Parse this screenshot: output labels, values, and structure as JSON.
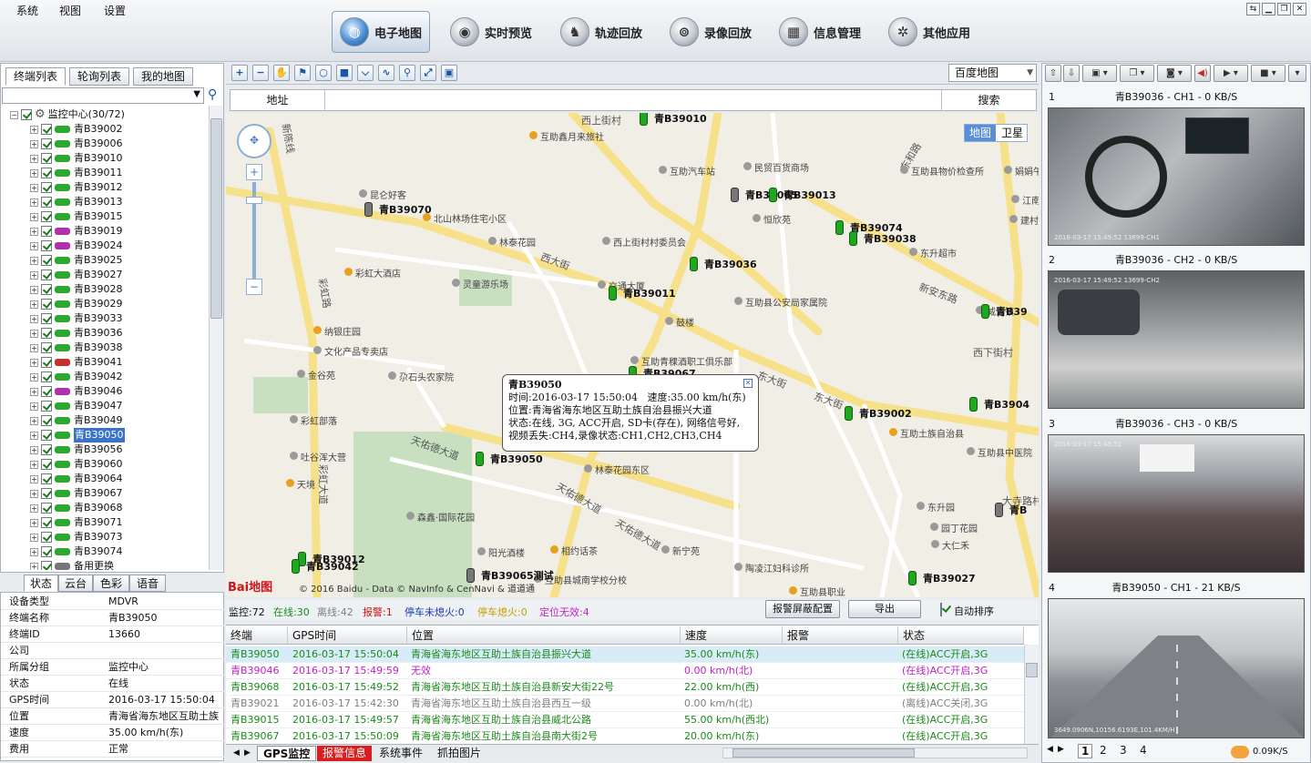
{
  "menu": [
    "系统",
    "视图",
    "设置"
  ],
  "nav": [
    {
      "label": "电子地图",
      "icon": "globe-icon",
      "active": true
    },
    {
      "label": "实时预览",
      "icon": "camera-icon"
    },
    {
      "label": "轨迹回放",
      "icon": "track-icon"
    },
    {
      "label": "录像回放",
      "icon": "video-reel-icon"
    },
    {
      "label": "信息管理",
      "icon": "info-icon"
    },
    {
      "label": "其他应用",
      "icon": "apps-icon"
    }
  ],
  "left_tabs": [
    "终端列表",
    "轮询列表",
    "我的地图"
  ],
  "tree": {
    "root": "监控中心(30/72)",
    "selected": "青B39050",
    "items": [
      {
        "name": "青B39002",
        "color": "#2ea82e"
      },
      {
        "name": "青B39006",
        "color": "#2ea82e"
      },
      {
        "name": "青B39010",
        "color": "#2ea82e"
      },
      {
        "name": "青B39011",
        "color": "#2ea82e"
      },
      {
        "name": "青B39012",
        "color": "#2ea82e"
      },
      {
        "name": "青B39013",
        "color": "#2ea82e"
      },
      {
        "name": "青B39015",
        "color": "#2ea82e"
      },
      {
        "name": "青B39019",
        "color": "#b030b0"
      },
      {
        "name": "青B39024",
        "color": "#b030b0"
      },
      {
        "name": "青B39025",
        "color": "#2ea82e"
      },
      {
        "name": "青B39027",
        "color": "#2ea82e"
      },
      {
        "name": "青B39028",
        "color": "#2ea82e"
      },
      {
        "name": "青B39029",
        "color": "#2ea82e"
      },
      {
        "name": "青B39033",
        "color": "#2ea82e"
      },
      {
        "name": "青B39036",
        "color": "#2ea82e"
      },
      {
        "name": "青B39038",
        "color": "#2ea82e"
      },
      {
        "name": "青B39041",
        "color": "#c83030"
      },
      {
        "name": "青B39042",
        "color": "#2ea82e"
      },
      {
        "name": "青B39046",
        "color": "#b030b0"
      },
      {
        "name": "青B39047",
        "color": "#2ea82e"
      },
      {
        "name": "青B39049",
        "color": "#2ea82e"
      },
      {
        "name": "青B39050",
        "color": "#2ea82e"
      },
      {
        "name": "青B39056",
        "color": "#2ea82e"
      },
      {
        "name": "青B39060",
        "color": "#2ea82e"
      },
      {
        "name": "青B39064",
        "color": "#2ea82e"
      },
      {
        "name": "青B39067",
        "color": "#2ea82e"
      },
      {
        "name": "青B39068",
        "color": "#2ea82e"
      },
      {
        "name": "青B39071",
        "color": "#2ea82e"
      },
      {
        "name": "青B39073",
        "color": "#2ea82e"
      },
      {
        "name": "青B39074",
        "color": "#2ea82e"
      },
      {
        "name": "备用更换",
        "color": "#777777"
      }
    ]
  },
  "status_tabs": [
    "状态",
    "云台",
    "色彩",
    "语音"
  ],
  "device_info": [
    {
      "k": "设备类型",
      "v": "MDVR"
    },
    {
      "k": "终端名称",
      "v": "青B39050"
    },
    {
      "k": "终端ID",
      "v": "13660"
    },
    {
      "k": "公司",
      "v": ""
    },
    {
      "k": "所属分组",
      "v": "监控中心"
    },
    {
      "k": "状态",
      "v": "在线"
    },
    {
      "k": "GPS时间",
      "v": "2016-03-17 15:50:04"
    },
    {
      "k": "位置",
      "v": "青海省海东地区互助土族"
    },
    {
      "k": "速度",
      "v": "35.00 km/h(东)"
    },
    {
      "k": "费用",
      "v": "正常"
    }
  ],
  "map": {
    "provider": "百度地图",
    "address_label": "地址",
    "search_label": "搜索",
    "type_map": "地图",
    "type_sat": "卫星",
    "copyright": "© 2016 Baidu - Data © NavInfo & CenNavi & 道道通",
    "logo": "Bai地图",
    "roads": [
      "西大街",
      "东大街",
      "东大街",
      "新安东路",
      "天佑德大道",
      "天佑德大道",
      "天佑德大道",
      "彩虹大道",
      "新陈线",
      "彩虹路",
      "东和路",
      "西上街村",
      "西下街村",
      "大寺路村"
    ],
    "pois": [
      "互助鑫月来旅社",
      "互助汽车站",
      "民贸百货商场",
      "互助县物价检查所",
      "昆仑好客",
      "北山林场住宅小区",
      "林泰花园",
      "西上街村村委员会",
      "恒欣苑",
      "东升超市",
      "彩虹大酒店",
      "灵童游乐场",
      "交通大厦",
      "互助县公安局家属院",
      "鼓楼",
      "纳银庄园",
      "文化产品专卖店",
      "金谷苑",
      "尕石头农家院",
      "互助青稞酒职工俱乐部",
      "互助土族自治县",
      "彩虹部落",
      "互助县中医院",
      "吐谷浑大营",
      "林泰花园东区",
      "天境",
      "森鑫·国际花园",
      "东升园",
      "园丁花园",
      "阳光酒楼",
      "相约话茶",
      "新宁苑",
      "大仁禾",
      "互助县城南学校分校",
      "陶凌江妇科诊所",
      "互助县职业",
      "威远镇",
      "娟娟午",
      "江南",
      "建村"
    ],
    "vehicles": [
      {
        "id": "青B39010"
      },
      {
        "id": "青B39065"
      },
      {
        "id": "青B39013"
      },
      {
        "id": "青B39070"
      },
      {
        "id": "青B39074"
      },
      {
        "id": "青B39038"
      },
      {
        "id": "青B39036"
      },
      {
        "id": "青B39011"
      },
      {
        "id": "青B39"
      },
      {
        "id": "青B39067"
      },
      {
        "id": "青B39002"
      },
      {
        "id": "青B3904"
      },
      {
        "id": "青B39050"
      },
      {
        "id": "青B39012"
      },
      {
        "id": "青B39042"
      },
      {
        "id": "青B39065测试"
      },
      {
        "id": "青B39027"
      },
      {
        "id": "青B"
      }
    ],
    "popup": {
      "title": "青B39050",
      "time": "时间:2016-03-17 15:50:04",
      "speed": "速度:35.00 km/h(东)",
      "position": "位置:青海省海东地区互助土族自治县振兴大道",
      "status": "状态:在线, 3G, ACC开启, SD卡(存在), 网络信号好,",
      "video": "视频丢失:CH4,录像状态:CH1,CH2,CH3,CH4"
    }
  },
  "stats": {
    "monitor": "监控:72",
    "online": "在线:30",
    "offline": "离线:42",
    "alarm": "报警:1",
    "stop_off": "停车未熄火:0",
    "stop_on": "停车熄火:0",
    "invalid": "定位无效:4",
    "btn_alarm_cfg": "报警屏蔽配置",
    "btn_export": "导出",
    "auto_sort": "自动排序"
  },
  "grid": {
    "headers": [
      "终端",
      "GPS时间",
      "位置",
      "速度",
      "报警",
      "状态"
    ],
    "rows": [
      {
        "term": "青B39050",
        "time": "2016-03-17 15:50:04",
        "pos": "青海省海东地区互助土族自治县振兴大道",
        "speed": "35.00 km/h(东)",
        "alarm": "",
        "status": "(在线)ACC开启,3G",
        "color": "#1a8a1a"
      },
      {
        "term": "青B39046",
        "time": "2016-03-17 15:49:59",
        "pos": "无效",
        "speed": "0.00 km/h(北)",
        "alarm": "",
        "status": "(在线)ACC开启,3G",
        "color": "#c020c0"
      },
      {
        "term": "青B39068",
        "time": "2016-03-17 15:49:52",
        "pos": "青海省海东地区互助土族自治县新安大街22号",
        "speed": "22.00 km/h(西)",
        "alarm": "",
        "status": "(在线)ACC开启,3G",
        "color": "#1a8a1a"
      },
      {
        "term": "青B39021",
        "time": "2016-03-17 15:42:30",
        "pos": "青海省海东地区互助土族自治县西互一级",
        "speed": "0.00 km/h(北)",
        "alarm": "",
        "status": "(离线)ACC关闭,3G",
        "color": "#808080"
      },
      {
        "term": "青B39015",
        "time": "2016-03-17 15:49:57",
        "pos": "青海省海东地区互助土族自治县威北公路",
        "speed": "55.00 km/h(西北)",
        "alarm": "",
        "status": "(在线)ACC开启,3G",
        "color": "#1a8a1a"
      },
      {
        "term": "青B39067",
        "time": "2016-03-17 15:50:09",
        "pos": "青海省海东地区互助土族自治县南大街2号",
        "speed": "20.00 km/h(东)",
        "alarm": "",
        "status": "(在线)ACC开启,3G",
        "color": "#1a8a1a"
      }
    ]
  },
  "bottom_tabs": [
    "GPS监控",
    "报警信息",
    "系统事件",
    "抓拍图片"
  ],
  "videos": [
    {
      "idx": "1",
      "title": "青B39036 - CH1 - 0 KB/S",
      "stamp": "2016-03-17 15:49:52  13699-CH1"
    },
    {
      "idx": "2",
      "title": "青B39036 - CH2 - 0 KB/S",
      "stamp": "2016-03-17 15:49:52  13699-CH2"
    },
    {
      "idx": "3",
      "title": "青B39036 - CH3 - 0 KB/S",
      "stamp": "2016-03-17 15:49:52"
    },
    {
      "idx": "4",
      "title": "青B39050 - CH1 - 21 KB/S",
      "stamp": "3649.0906N,10156.6193E,101.4KM/H"
    }
  ],
  "video_pages": [
    "1",
    "2",
    "3",
    "4"
  ],
  "net_speed": "0.09K/S"
}
